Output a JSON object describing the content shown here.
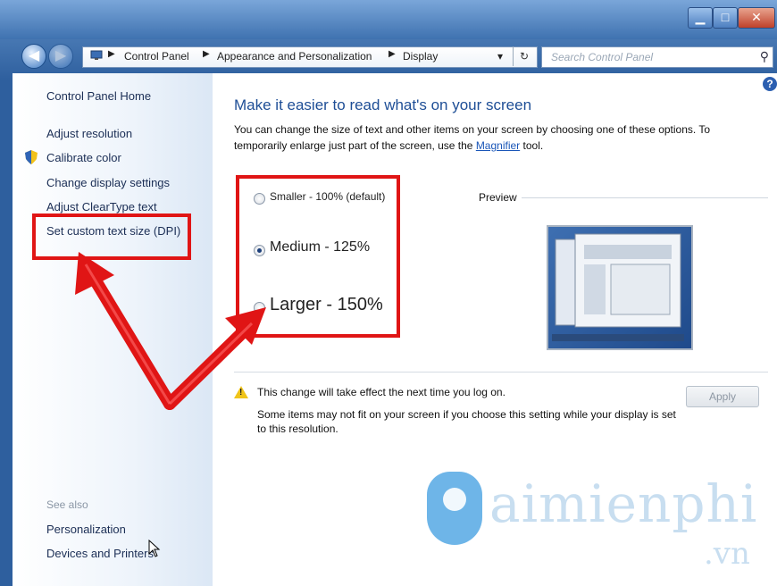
{
  "window": {
    "minimize": "▁",
    "maximize": "□",
    "close": "✕"
  },
  "nav": {
    "back_icon": "arrow-left-icon",
    "forward_icon": "arrow-right-icon",
    "breadcrumb": [
      "Control Panel",
      "Appearance and Personalization",
      "Display"
    ],
    "dropdown_icon": "▾",
    "refresh_icon": "↻",
    "search_placeholder": "Search Control Panel",
    "search_icon": "⚲"
  },
  "sidebar": {
    "home": "Control Panel Home",
    "items": [
      "Adjust resolution",
      "Calibrate color",
      "Change display settings",
      "Adjust ClearType text",
      "Set custom text size (DPI)"
    ],
    "see_also": "See also",
    "see_also_items": [
      "Personalization",
      "Devices and Printers"
    ]
  },
  "main": {
    "help": "?",
    "heading": "Make it easier to read what's on your screen",
    "description_1": "You can change the size of text and other items on your screen by choosing one of these options. To temporarily enlarge just part of the screen, use the ",
    "magnifier_link": "Magnifier",
    "description_2": " tool.",
    "options": [
      {
        "label": "Smaller - 100% (default)",
        "selected": false
      },
      {
        "label": "Medium - 125%",
        "selected": true
      },
      {
        "label": "Larger - 150%",
        "selected": false
      }
    ],
    "preview_label": "Preview",
    "notice": "This change will take effect the next time you log on.",
    "subnote": "Some items may not fit on your screen if you choose this setting while your display is set to this resolution.",
    "apply_label": "Apply"
  },
  "watermark": {
    "word": "aimienphi",
    "domain": ".vn"
  },
  "colors": {
    "annotation_red": "#e01515",
    "heading_blue": "#1e4e96"
  }
}
